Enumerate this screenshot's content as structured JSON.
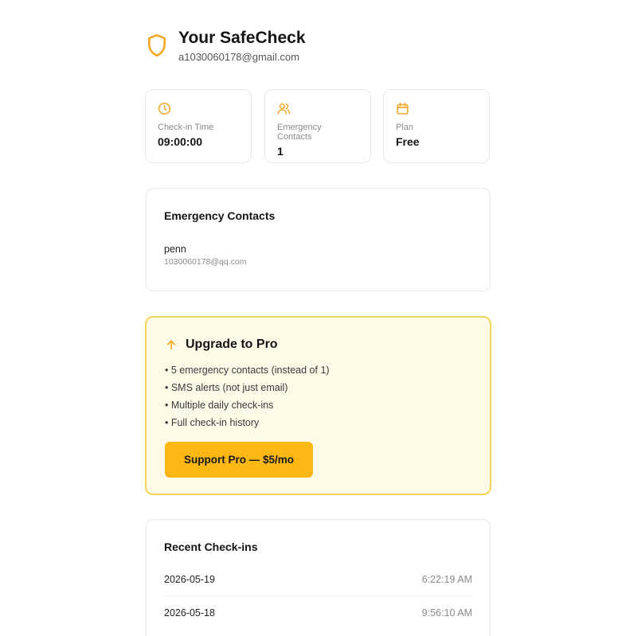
{
  "header": {
    "title": "Your SafeCheck",
    "email": "a1030060178@gmail.com",
    "icon": "shield-icon"
  },
  "stats": [
    {
      "icon": "clock-icon",
      "label": "Check-in Time",
      "value": "09:00:00"
    },
    {
      "icon": "users-icon",
      "label": "Emergency Contacts",
      "value": "1"
    },
    {
      "icon": "calendar-icon",
      "label": "Plan",
      "value": "Free"
    }
  ],
  "contacts": {
    "title": "Emergency Contacts",
    "items": [
      {
        "name": "penn",
        "email": "1030060178@qq.com"
      }
    ]
  },
  "upgrade": {
    "title": "Upgrade to Pro",
    "icon": "arrow-up-icon",
    "features": [
      "• 5 emergency contacts (instead of 1)",
      "• SMS alerts (not just email)",
      "• Multiple daily check-ins",
      "• Full check-in history"
    ],
    "button_label": "Support Pro — $5/mo"
  },
  "recent": {
    "title": "Recent Check-ins",
    "items": [
      {
        "date": "2026-05-19",
        "time": "6:22:19 AM"
      },
      {
        "date": "2026-05-18",
        "time": "9:56:10 AM"
      }
    ]
  },
  "colors": {
    "accent": "#f5a623",
    "upgrade_bg": "#fefae8",
    "upgrade_border": "#f5d557",
    "button": "#fbb713"
  }
}
